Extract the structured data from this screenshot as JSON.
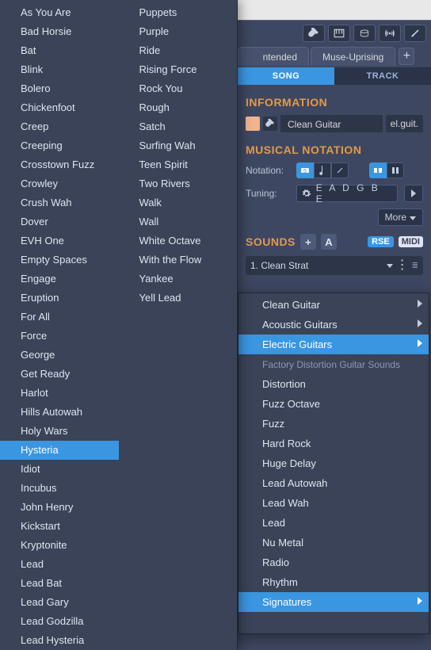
{
  "tabs": {
    "song": "SONG",
    "track": "TRACK"
  },
  "doc_tabs": {
    "left": "ntended",
    "right": "Muse-Uprising",
    "add": "+"
  },
  "sections": {
    "information": "INFORMATION",
    "notation": "MUSICAL NOTATION",
    "sounds": "SOUNDS"
  },
  "info": {
    "name": "Clean Guitar",
    "short": "el.guit."
  },
  "notation": {
    "label": "Notation:",
    "tuning_label": "Tuning:",
    "tuning": "E A D G B E",
    "more": "More"
  },
  "sounds": {
    "plus": "+",
    "a": "A",
    "rse": "RSE",
    "midi": "MIDI",
    "slot": "1. Clean Strat"
  },
  "categories": [
    {
      "label": "Clean Guitar",
      "arrow": true
    },
    {
      "label": "Acoustic Guitars",
      "arrow": true
    },
    {
      "label": "Electric Guitars",
      "arrow": true,
      "selected": true
    },
    {
      "label": "Factory Distortion Guitar Sounds",
      "header": true
    },
    {
      "label": "Distortion"
    },
    {
      "label": "Fuzz Octave"
    },
    {
      "label": "Fuzz"
    },
    {
      "label": "Hard Rock"
    },
    {
      "label": "Huge Delay"
    },
    {
      "label": "Lead Autowah"
    },
    {
      "label": "Lead Wah"
    },
    {
      "label": "Lead"
    },
    {
      "label": "Nu Metal"
    },
    {
      "label": "Radio"
    },
    {
      "label": "Rhythm"
    },
    {
      "label": "Signatures",
      "arrow": true,
      "selected": true
    },
    {
      "label": ""
    }
  ],
  "presets_col1": [
    "As You Are",
    "Bad Horsie",
    "Bat",
    "Blink",
    "Bolero",
    "Chickenfoot",
    "Creep",
    "Creeping",
    "Crosstown Fuzz",
    "Crowley",
    "Crush Wah",
    "Dover",
    "EVH One",
    "Empty Spaces",
    "Engage",
    "Eruption",
    "For All",
    "Force",
    "George",
    "Get Ready",
    "Harlot",
    "Hills Autowah",
    "Holy Wars",
    "Hysteria",
    "Idiot",
    "Incubus",
    "John Henry",
    "Kickstart",
    "Kryptonite",
    "Lead",
    "Lead Bat",
    "Lead Gary",
    "Lead Godzilla",
    "Lead Hysteria"
  ],
  "presets_col1_selected": "Hysteria",
  "presets_col2": [
    "Puppets",
    "Purple",
    "Ride",
    "Rising Force",
    "Rock You",
    "Rough",
    "Satch",
    "Surfing Wah",
    "Teen Spirit",
    "Two Rivers",
    "Walk",
    "Wall",
    "White Octave",
    "With the Flow",
    "Yankee",
    "Yell Lead"
  ]
}
